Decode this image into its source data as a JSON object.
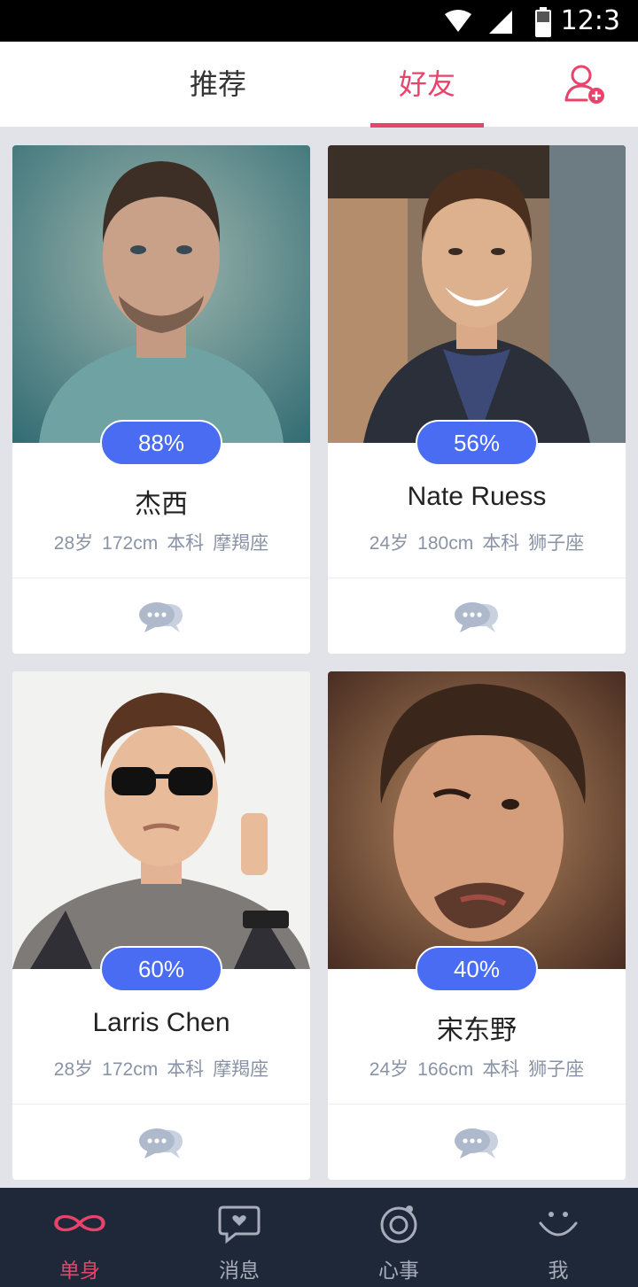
{
  "status_bar": {
    "time": "12:3",
    "icons": [
      "wifi-icon",
      "signal-icon",
      "battery-icon"
    ]
  },
  "top_tabs": {
    "tabs": [
      {
        "label": "推荐",
        "active": false
      },
      {
        "label": "好友",
        "active": true
      }
    ],
    "add_friend_icon": "add-user-icon"
  },
  "cards": [
    {
      "match": "88%",
      "name": "杰西",
      "age": "28岁",
      "height": "172cm",
      "education": "本科",
      "zodiac": "摩羯座",
      "chat_icon": "chat-bubbles-icon"
    },
    {
      "match": "56%",
      "name": "Nate Ruess",
      "age": "24岁",
      "height": "180cm",
      "education": "本科",
      "zodiac": "狮子座",
      "chat_icon": "chat-bubbles-icon"
    },
    {
      "match": "60%",
      "name": "Larris Chen",
      "age": "28岁",
      "height": "172cm",
      "education": "本科",
      "zodiac": "摩羯座",
      "chat_icon": "chat-bubbles-icon"
    },
    {
      "match": "40%",
      "name": "宋东野",
      "age": "24岁",
      "height": "166cm",
      "education": "本科",
      "zodiac": "狮子座",
      "chat_icon": "chat-bubbles-icon"
    }
  ],
  "bottom_nav": {
    "items": [
      {
        "label": "单身",
        "icon": "infinity-icon",
        "active": true
      },
      {
        "label": "消息",
        "icon": "message-heart-icon",
        "active": false
      },
      {
        "label": "心事",
        "icon": "target-circle-icon",
        "active": false
      },
      {
        "label": "我",
        "icon": "smiley-icon",
        "active": false
      }
    ]
  },
  "colors": {
    "accent": "#e8436b",
    "badge": "#4a6cf3",
    "nav_bg": "#1f2838",
    "page_bg": "#e1e3e8"
  }
}
